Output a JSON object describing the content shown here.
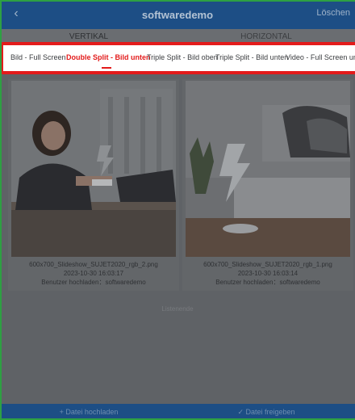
{
  "header": {
    "title": "softwaredemo",
    "back_icon": "chevron-left-icon",
    "back_symbol": "‹",
    "delete_label": "Löschen"
  },
  "orientation_tabs": [
    {
      "label": "VERTIKAL",
      "active": true
    },
    {
      "label": "HORIZONTAL",
      "active": false
    }
  ],
  "mode_tabs": [
    {
      "label": "Bild - Full Screen",
      "active": false
    },
    {
      "label": "Double Split - Bild unten",
      "active": true
    },
    {
      "label": "Triple Split - Bild oben",
      "active": false
    },
    {
      "label": "Triple Split - Bild unten",
      "active": false
    },
    {
      "label": "Video - Full Screen und S",
      "active": false
    }
  ],
  "media": [
    {
      "filename": "600x700_Slideshow_SUJET2020_rgb_2.png",
      "date": "2023-10-30 16:03:17",
      "uploader": "Benutzer hochladen：softwaredemo"
    },
    {
      "filename": "600x700_Slideshow_SUJET2020_rgb_1.png",
      "date": "2023-10-30 16:03:14",
      "uploader": "Benutzer hochladen：softwaredemo"
    }
  ],
  "list_end": "Listenende",
  "footer": {
    "upload_label": "+ Datei hochladen",
    "share_label": "✓ Datei freigeben"
  },
  "colors": {
    "header": "#1d4e85",
    "accent_red": "#e31b1b",
    "overlay": "#5f6266"
  }
}
